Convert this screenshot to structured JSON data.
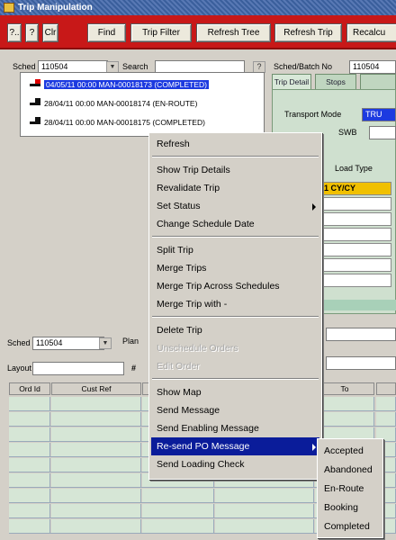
{
  "window": {
    "title": "Trip Manipulation"
  },
  "toolbar": {
    "buttons": [
      {
        "label": "?.."
      },
      {
        "label": "?"
      },
      {
        "label": "Clr"
      },
      {
        "label": "Find"
      },
      {
        "label": "Trip Filter"
      },
      {
        "label": "Refresh Tree"
      },
      {
        "label": "Refresh Trip"
      },
      {
        "label": "Recalcu"
      }
    ]
  },
  "top_left": {
    "sched_label": "Sched",
    "sched_value": "110504",
    "search_label": "Search",
    "search_value": "",
    "help_label": "?"
  },
  "tree": {
    "items": [
      {
        "text": "04/05/11 00:00 MAN-00018173 (COMPLETED)",
        "selected": true
      },
      {
        "text": "28/04/11 00:00 MAN-00018174 (EN-ROUTE)"
      },
      {
        "text": "28/04/11 00:00 MAN-00018175 (COMPLETED)"
      }
    ]
  },
  "right_pane": {
    "sched_batch_label": "Sched/Batch No",
    "sched_batch_value": "110504",
    "tabs": [
      {
        "label": "Trip Detail"
      },
      {
        "label": "Stops"
      }
    ],
    "transport_mode_label": "Transport Mode",
    "transport_mode_value": "TRU",
    "swb_label": "SWB",
    "load_type_label": "Load Type",
    "load_type_first": "1 CY/CY"
  },
  "lower_left": {
    "sched_label": "Sched",
    "sched_value": "110504",
    "plan_label": "Plan",
    "layout_label": "Layout",
    "hash_label": "#"
  },
  "grid": {
    "headers": [
      "Ord Id",
      "Cust Ref",
      "To"
    ]
  },
  "context_menu": {
    "items": [
      {
        "label": "Refresh"
      },
      {
        "label": "Show Trip Details"
      },
      {
        "label": "Revalidate Trip"
      },
      {
        "label": "Set Status"
      },
      {
        "label": "Change Schedule Date"
      },
      {
        "label": "Split Trip"
      },
      {
        "label": "Merge Trips"
      },
      {
        "label": "Merge Trip Across Schedules"
      },
      {
        "label": "Merge Trip with -"
      },
      {
        "label": "Delete Trip"
      },
      {
        "label": "Unschedule Orders"
      },
      {
        "label": "Edit Order"
      },
      {
        "label": "Show Map"
      },
      {
        "label": "Send Message"
      },
      {
        "label": "Send Enabling Message"
      },
      {
        "label": "Re-send PO Message"
      },
      {
        "label": "Send Loading Check"
      }
    ]
  },
  "submenu": {
    "items": [
      {
        "label": "Accepted"
      },
      {
        "label": "Abandoned"
      },
      {
        "label": "En-Route"
      },
      {
        "label": "Booking"
      },
      {
        "label": "Completed"
      }
    ]
  },
  "colors": {
    "toolbar_red": "#c81818",
    "selection_blue": "#1c3ae0",
    "menu_highlight": "#0a1c9a",
    "tab_panel_green": "#cfe0cf",
    "load_type_yellow": "#f0c000"
  }
}
